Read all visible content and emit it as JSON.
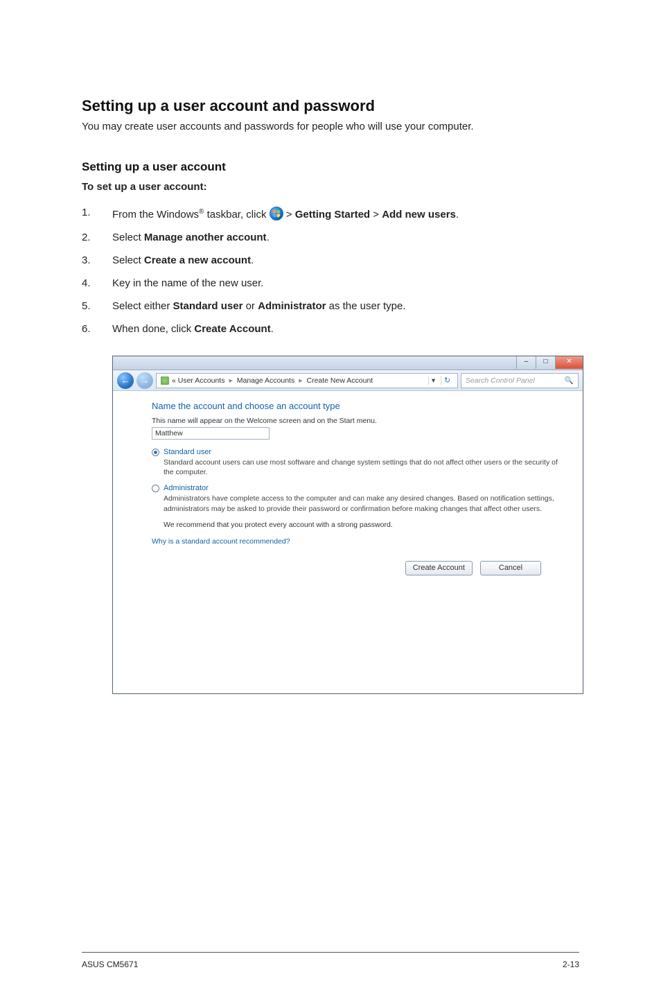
{
  "heading_main": "Setting up a user account and password",
  "intro": "You may create user accounts and passwords for people who will use your computer.",
  "heading_sub": "Setting up a user account",
  "heading_bold": "To set up a user account:",
  "steps": {
    "s1_num": "1.",
    "s1_a": "From the Windows",
    "s1_reg": "®",
    "s1_b": " taskbar, click ",
    "s1_menu1": "Getting Started",
    "s1_sep": " > ",
    "s1_menu2": "Add new users",
    "s1_end": ".",
    "s2_num": "2.",
    "s2_a": "Select ",
    "s2_b": "Manage another account",
    "s2_c": ".",
    "s3_num": "3.",
    "s3_a": "Select ",
    "s3_b": "Create a new account",
    "s3_c": ".",
    "s4_num": "4.",
    "s4_a": "Key in the name of the new user.",
    "s5_num": "5.",
    "s5_a": "Select either ",
    "s5_b": "Standard user",
    "s5_c": " or ",
    "s5_d": "Administrator",
    "s5_e": " as the user type.",
    "s6_num": "6.",
    "s6_a": "When done, click ",
    "s6_b": "Create Account",
    "s6_c": "."
  },
  "window": {
    "title_min": "–",
    "title_max": "□",
    "title_close": "✕",
    "back": "←",
    "fwd": "→",
    "breadcrumb_a": "« User Accounts",
    "breadcrumb_b": "Manage Accounts",
    "breadcrumb_c": "Create New Account",
    "addr_sep": "▸",
    "addr_drop": "▾",
    "addr_refresh": "↻",
    "search_placeholder": "Search Control Panel",
    "search_icon": "🔍",
    "h": "Name the account and choose an account type",
    "sub": "This name will appear on the Welcome screen and on the Start menu.",
    "name_value": "Matthew",
    "opt1_label": "Standard user",
    "opt1_desc": "Standard account users can use most software and change system settings that do not affect other users or the security of the computer.",
    "opt2_label": "Administrator",
    "opt2_desc": "Administrators have complete access to the computer and can make any desired changes. Based on notification settings, administrators may be asked to provide their password or confirmation before making changes that affect other users.",
    "recommend": "We recommend that you protect every account with a strong password.",
    "link": "Why is a standard account recommended?",
    "btn_create": "Create Account",
    "btn_cancel": "Cancel"
  },
  "footer_left": "ASUS CM5671",
  "footer_right": "2-13"
}
